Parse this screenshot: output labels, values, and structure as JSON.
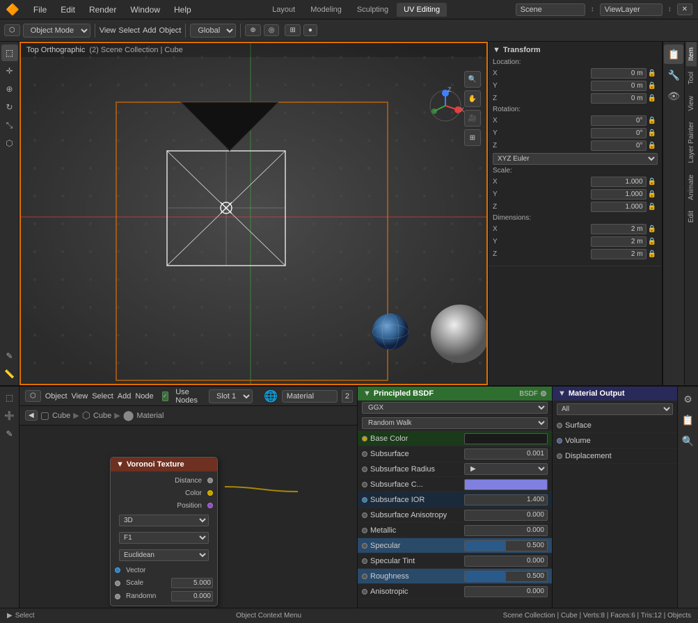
{
  "topbar": {
    "logo": "🔶",
    "menus": [
      "File",
      "Edit",
      "Render",
      "Window",
      "Help"
    ],
    "workspace_tabs": [
      "Layout",
      "Modeling",
      "Sculpting",
      "UV Editing"
    ],
    "scene_label": "Scene",
    "viewlayer_label": "ViewLayer"
  },
  "main_toolbar": {
    "mode_label": "Object Mode",
    "view_label": "View",
    "select_label": "Select",
    "add_label": "Add",
    "object_label": "Object",
    "transform_label": "Global",
    "pivot_label": "Individual Origins"
  },
  "viewport": {
    "label": "Top Orthographic",
    "collection": "(2) Scene Collection | Cube"
  },
  "transform": {
    "title": "Transform",
    "location_label": "Location:",
    "x_loc": "0 m",
    "y_loc": "0 m",
    "z_loc": "0 m",
    "rotation_label": "Rotation:",
    "x_rot": "0°",
    "y_rot": "0°",
    "z_rot": "0°",
    "euler_mode": "XYZ Euler",
    "scale_label": "Scale:",
    "x_scale": "1.000",
    "y_scale": "1.000",
    "z_scale": "1.000",
    "dimensions_label": "Dimensions:",
    "x_dim": "2 m",
    "y_dim": "2 m",
    "z_dim": "2 m"
  },
  "node_editor": {
    "toolbar": {
      "object_label": "Object",
      "view_label": "View",
      "select_label": "Select",
      "add_label": "Add",
      "node_label": "Node",
      "use_nodes_label": "Use Nodes",
      "slot_label": "Slot 1",
      "material_label": "Material",
      "slot_num": "2"
    },
    "breadcrumb": [
      "Cube",
      "Cube",
      "Material"
    ],
    "voronoi_node": {
      "title": "Voronoi Texture",
      "sockets_out": [
        "Distance",
        "Color",
        "Position"
      ],
      "mode_3d": "3D",
      "mode_f1": "F1",
      "mode_euclidean": "Euclidean",
      "socket_in": "Vector",
      "scale_label": "Scale",
      "scale_value": "5.000",
      "random_label": "Randomn",
      "random_value": "0.000"
    },
    "bsdf_node": {
      "title": "Principled BSDF",
      "bsdf_label": "BSDF",
      "dist_label": "GGX",
      "sss_label": "Random Walk",
      "rows": [
        {
          "label": "Base Color",
          "value": "",
          "type": "color",
          "highlight": false
        },
        {
          "label": "Subsurface",
          "value": "0.001",
          "type": "number",
          "highlight": false
        },
        {
          "label": "Subsurface Radius",
          "value": "",
          "type": "dropdown",
          "highlight": false
        },
        {
          "label": "Subsurface C...",
          "value": "",
          "type": "color",
          "highlight": false
        },
        {
          "label": "Subsurface IOR",
          "value": "1.400",
          "type": "number",
          "highlight": false
        },
        {
          "label": "Subsurface Anisotropy",
          "value": "0.000",
          "type": "number",
          "highlight": false
        },
        {
          "label": "Metallic",
          "value": "0.000",
          "type": "number",
          "highlight": false
        },
        {
          "label": "Specular",
          "value": "0.500",
          "type": "number",
          "highlight": true
        },
        {
          "label": "Specular Tint",
          "value": "0.000",
          "type": "number",
          "highlight": false
        },
        {
          "label": "Roughness",
          "value": "0.500",
          "type": "number",
          "highlight": true
        },
        {
          "label": "Anisotropic",
          "value": "0.000",
          "type": "number",
          "highlight": false
        }
      ]
    },
    "mat_output_node": {
      "title": "Material Output",
      "all_label": "All",
      "sockets": [
        "Surface",
        "Volume",
        "Displacement"
      ]
    }
  },
  "statusbar": {
    "left_icon": "▶",
    "left_label": "Select",
    "center_label": "Object Context Menu",
    "right_label": "Scene Collection | Cube | Verts:8 | Faces:6 | Tris:12 | Objects"
  }
}
